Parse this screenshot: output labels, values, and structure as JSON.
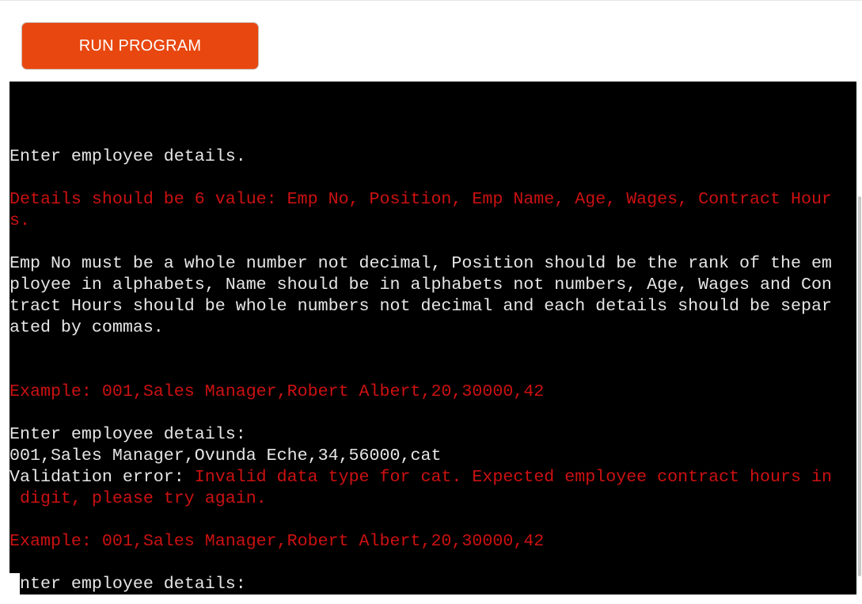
{
  "toolbar": {
    "run_label": "RUN PROGRAM",
    "run_color": "#e8470f"
  },
  "terminal": {
    "background": "#000000",
    "text_color": "#e6e6e6",
    "error_color": "#cc1111",
    "lines": [
      [
        {
          "t": "",
          "s": "n"
        }
      ],
      [
        {
          "t": "Enter employee details.",
          "s": "n"
        }
      ],
      [
        {
          "t": "",
          "s": "n"
        }
      ],
      [
        {
          "t": "Details should be 6 value: Emp No, Position, Emp Name, Age, Wages, Contract Hour",
          "s": "e"
        }
      ],
      [
        {
          "t": "s.",
          "s": "e"
        }
      ],
      [
        {
          "t": "",
          "s": "n"
        }
      ],
      [
        {
          "t": "Emp No must be a whole number not decimal, Position should be the rank of the em",
          "s": "n"
        }
      ],
      [
        {
          "t": "ployee in alphabets, Name should be in alphabets not numbers, Age, Wages and Con",
          "s": "n"
        }
      ],
      [
        {
          "t": "tract Hours should be whole numbers not decimal and each details should be separ",
          "s": "n"
        }
      ],
      [
        {
          "t": "ated by commas.",
          "s": "n"
        }
      ],
      [
        {
          "t": "",
          "s": "n"
        }
      ],
      [
        {
          "t": "",
          "s": "n"
        }
      ],
      [
        {
          "t": "Example: 001,Sales Manager,Robert Albert,20,30000,42",
          "s": "e"
        }
      ],
      [
        {
          "t": "",
          "s": "n"
        }
      ],
      [
        {
          "t": "Enter employee details:",
          "s": "n"
        }
      ],
      [
        {
          "t": "001,Sales Manager,Ovunda Eche,34,56000,cat",
          "s": "n"
        }
      ],
      [
        {
          "t": "Validation error: ",
          "s": "n"
        },
        {
          "t": "Invalid data type for cat. Expected employee contract hours in",
          "s": "e"
        }
      ],
      [
        {
          "t": " digit, please try again.",
          "s": "e"
        }
      ],
      [
        {
          "t": "",
          "s": "n"
        }
      ],
      [
        {
          "t": "Example: 001,Sales Manager,Robert Albert,20,30000,42",
          "s": "e"
        }
      ],
      [
        {
          "t": "",
          "s": "n"
        }
      ],
      [
        {
          "t": "Enter employee details:",
          "s": "n"
        }
      ]
    ]
  }
}
